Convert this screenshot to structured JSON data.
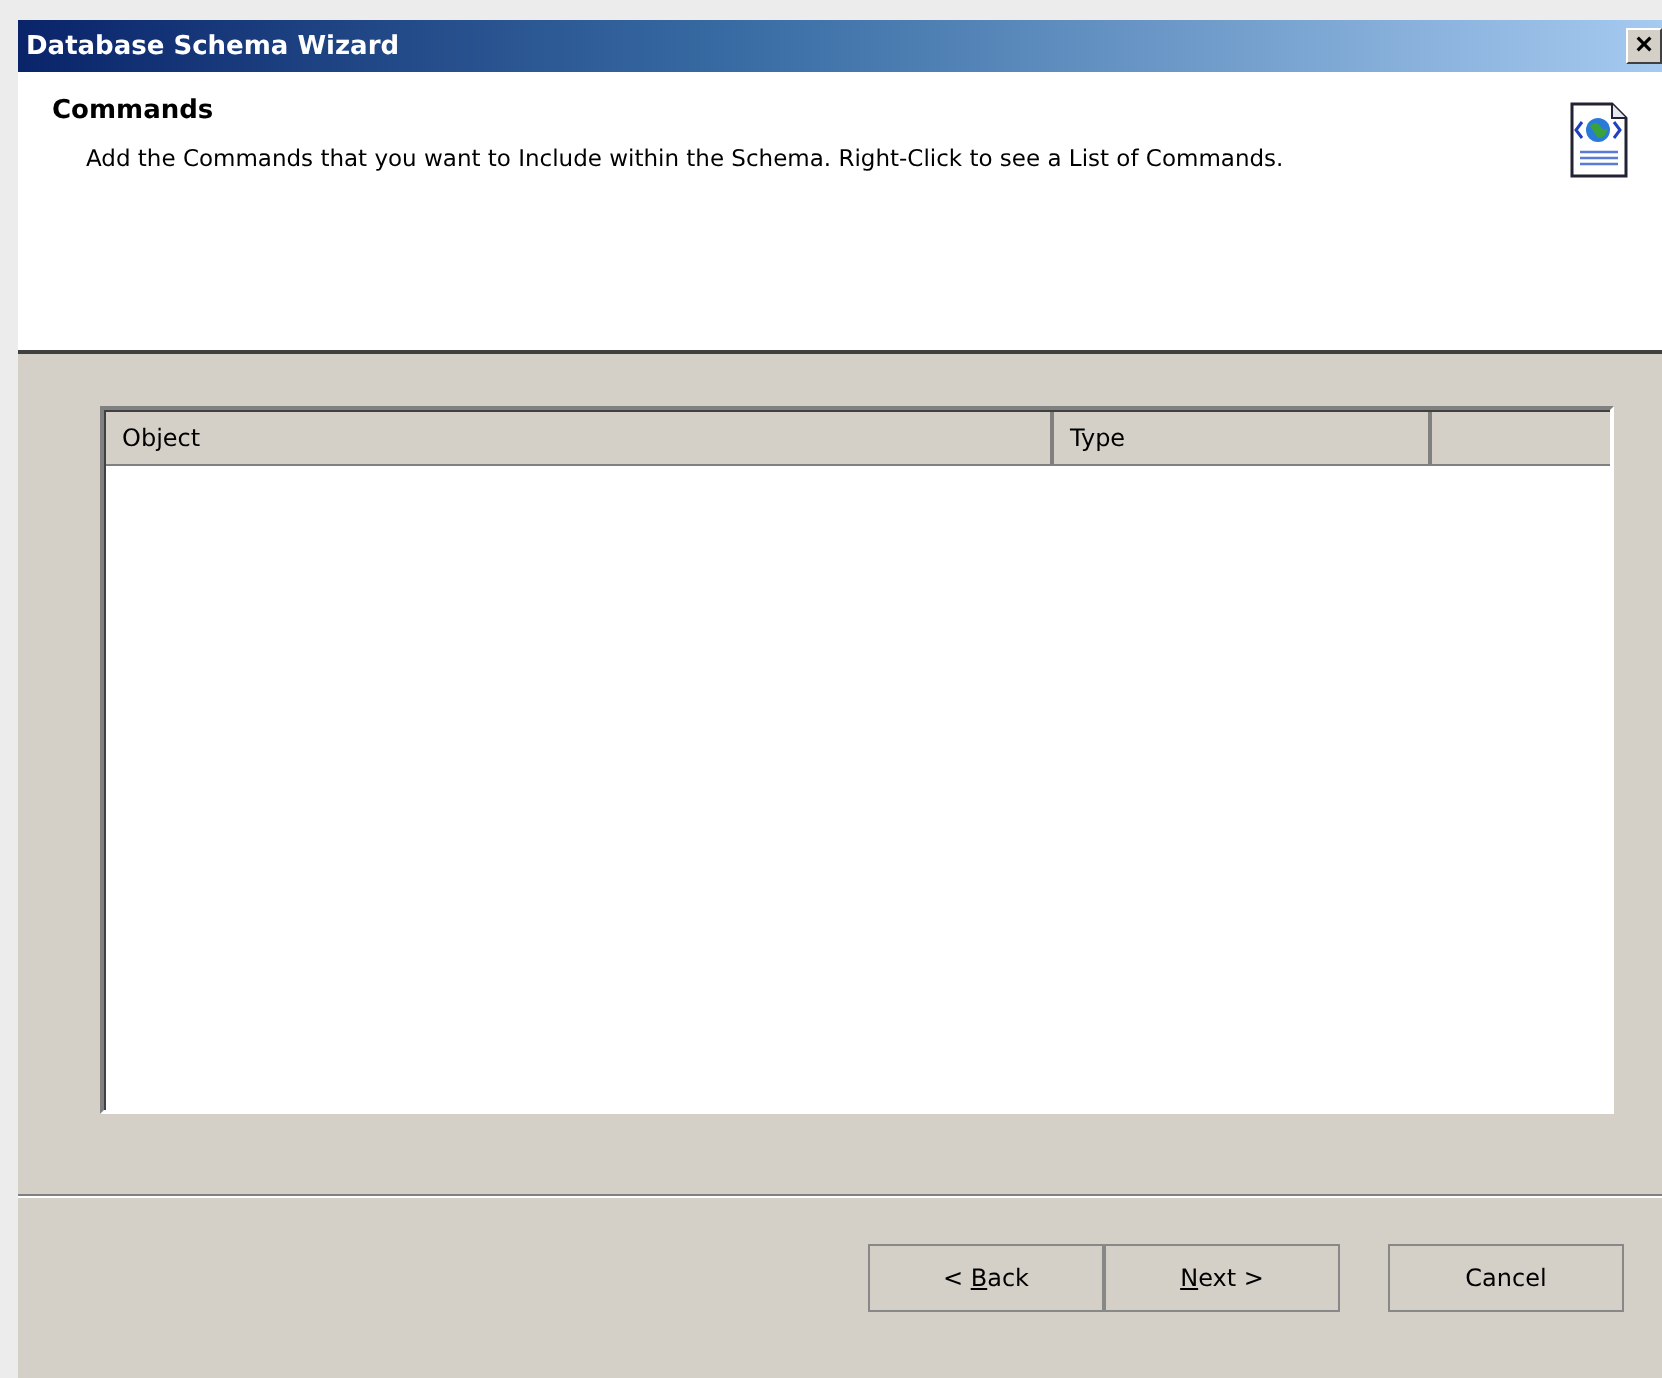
{
  "window": {
    "title": "Database Schema Wizard",
    "close": "×"
  },
  "header": {
    "title": "Commands",
    "description": "Add the Commands that you want to Include within the Schema. Right-Click to see a List of Commands."
  },
  "list": {
    "columns": [
      "Object",
      "Type"
    ]
  },
  "buttons": [
    {
      "prefix": "< ",
      "key": "B",
      "rest": "ack"
    },
    {
      "key": "N",
      "rest": "ext >"
    },
    {
      "prefix": "Cancel"
    }
  ]
}
